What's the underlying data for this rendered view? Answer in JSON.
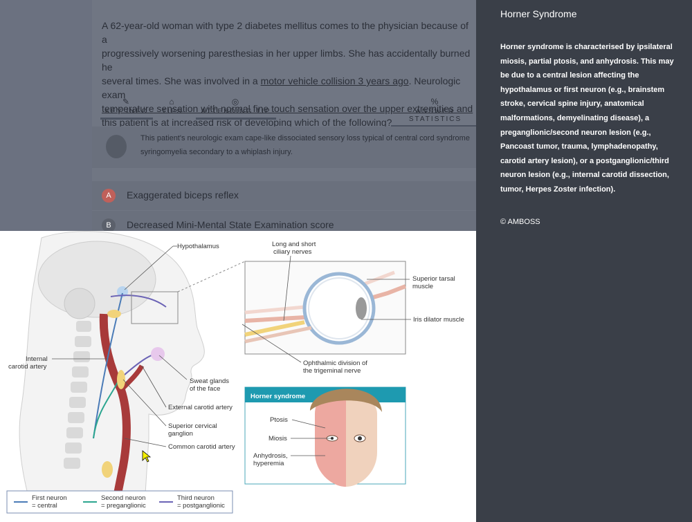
{
  "question": {
    "line1": "A 62-year-old woman with type 2 diabetes mellitus comes to the physician because of a",
    "line2": "progressively worsening paresthesias in her upper limbs. She has accidentally burned he",
    "line3a": "several times. She was involved in a ",
    "line3link": "motor vehicle collision 3 years ago",
    "line3b": ". Neurologic exam",
    "line4": "temperature sensation with normal fine touch sensation over the upper extremities and",
    "line5": "this patient is at increased risk of developing which of the following?"
  },
  "tabs": {
    "key_info": "KEY INFO",
    "tips": "TIPS",
    "attending_tip": "ATTENDING TIP",
    "answer_statistics": "ANSWER STATISTICS"
  },
  "explanation": {
    "line1": "This patient's neurologic exam cape-like dissociated sensory loss typical of central cord syndrome",
    "line2": "syringomyelia secondary to a whiplash injury."
  },
  "options": [
    {
      "letter": "A",
      "label": "Exaggerated biceps reflex",
      "badge_color": "#c0605a"
    },
    {
      "letter": "B",
      "label": "Decreased Mini-Mental State Examination score",
      "badge_color": "#5b606b"
    }
  ],
  "figure": {
    "labels": {
      "hypothalamus": "Hypothalamus",
      "ciliary1": "Long and short",
      "ciliary2": "ciliary nerves",
      "tarsal1": "Superior tarsal",
      "tarsal2": "muscle",
      "iris": "Iris dilator muscle",
      "ophthalmic1": "Ophthalmic division of",
      "ophthalmic2": "the trigeminal nerve",
      "ica1": "Internal",
      "ica2": "carotid artery",
      "sweat1": "Sweat glands",
      "sweat2": "of the face",
      "eca": "External carotid artery",
      "scg1": "Superior cervical",
      "scg2": "ganglion",
      "cca": "Common carotid artery",
      "horner_box_title": "Horner syndrome",
      "ptosis": "Ptosis",
      "miosis": "Miosis",
      "anhydrosis1": "Anhydrosis,",
      "anhydrosis2": "hyperemia"
    },
    "legend": [
      {
        "line1": "First neuron",
        "line2": "= central",
        "color": "#4a7bb7"
      },
      {
        "line1": "Second neuron",
        "line2": "= preganglionic",
        "color": "#2ba58f"
      },
      {
        "line1": "Third neuron",
        "line2": "= postganglionic",
        "color": "#6b63b5"
      }
    ]
  },
  "sidebar": {
    "title": "Horner Syndrome",
    "description": "Horner syndrome is characterised by ipsilateral miosis, partial ptosis, and anhydrosis. This may be due to a central lesion affecting the hypothalamus or first neuron (e.g., brainstem stroke, cervical spine injury, anatomical malformations, demyelinating disease), a preganglionic/second neuron lesion (e.g., Pancoast tumor, trauma, lymphadenopathy, carotid artery lesion), or a postganglionic/third neuron lesion (e.g., internal carotid dissection, tumor, Herpes Zoster infection).",
    "copyright": "© AMBOSS"
  }
}
